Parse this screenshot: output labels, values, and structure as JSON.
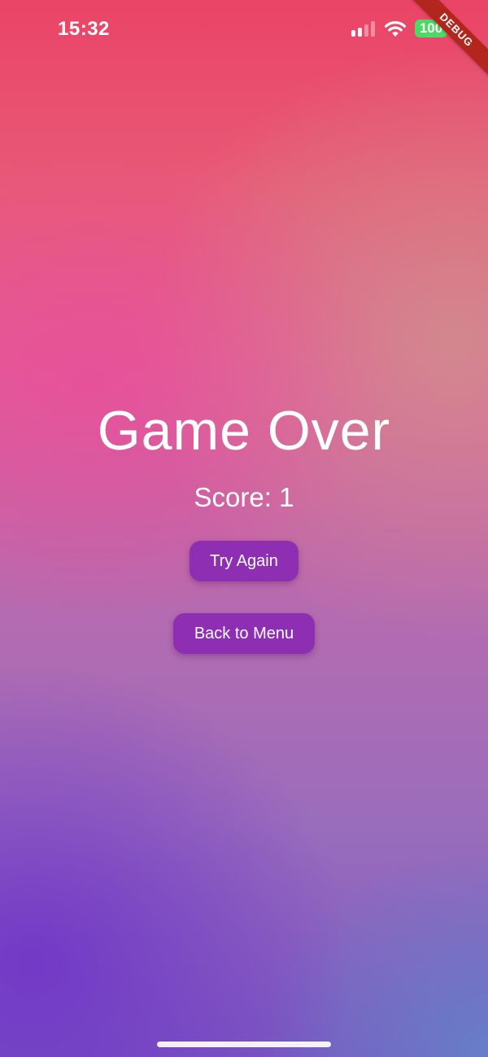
{
  "status_bar": {
    "time": "15:32",
    "battery": "100",
    "signal_icon": "cellular-signal-icon",
    "wifi_icon": "wifi-icon",
    "battery_color": "#4cd964"
  },
  "debug_banner": {
    "label": "DEBUG",
    "color": "#b3261e"
  },
  "game_over": {
    "title": "Game Over",
    "score_text": "Score: 1",
    "try_again_label": "Try Again",
    "back_to_menu_label": "Back to Menu",
    "button_color": "#8e2fb3"
  }
}
